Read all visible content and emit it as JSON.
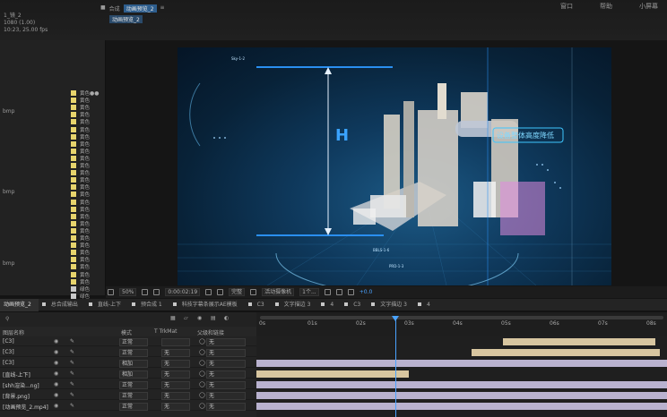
{
  "top": {
    "menu_right": [
      "窗口",
      "帮助",
      "小屏幕"
    ],
    "title_info": [
      "1_镜_2",
      "1080 (1.00)",
      "10:23, 25.00 fps"
    ],
    "comp_tabs": [
      "合成",
      "动画预览_2"
    ],
    "viewer_tab": "动画预览_2"
  },
  "project": {
    "names": [
      "bmp",
      "bmp",
      "bmp"
    ],
    "items": [
      "黄色",
      "黄色",
      "黄色",
      "黄色",
      "黄色",
      "黄色",
      "黄色",
      "黄色",
      "黄色",
      "黄色",
      "黄色",
      "黄色",
      "黄色",
      "黄色",
      "黄色",
      "黄色",
      "黄色",
      "黄色",
      "黄色",
      "黄色",
      "黄色",
      "黄色",
      "黄色",
      "黄色",
      "黄色",
      "黄色",
      "黄色",
      "绿色",
      "绿色",
      "绿色"
    ]
  },
  "render": {
    "height_label": "H",
    "callout": "设备整体高度降低",
    "bottom_labels": [
      "BBLS-1-6",
      "PRD-1-3"
    ],
    "sky_label": "Sky-1-2"
  },
  "viewer_toolbar": {
    "zoom": "50%",
    "timecode": "0:00:02:19",
    "view_mode": "完整",
    "camera": "活动摄像机",
    "views": "1个...",
    "exposure": "+0.0"
  },
  "timeline_tabs": [
    "动画预览_2",
    "总合成输出",
    "直线-上下",
    "预合成 1",
    "科技字幕条展示AE模板",
    "C3",
    "文字描边 3",
    "4",
    "C3",
    "文字描边 3",
    "4"
  ],
  "layer_header": {
    "name": "图层名称",
    "mode": "模式",
    "trkmat": "T TrkMat",
    "parent": "父级和链接"
  },
  "layers": [
    {
      "name": "[C3]",
      "mode": "正常",
      "trkmat": "",
      "parent": "无"
    },
    {
      "name": "[C3]",
      "mode": "正常",
      "trkmat": "无",
      "parent": "无"
    },
    {
      "name": "[C3]",
      "mode": "相加",
      "trkmat": "无",
      "parent": "无"
    },
    {
      "name": "[直线-上下]",
      "mode": "相加",
      "trkmat": "无",
      "parent": "无"
    },
    {
      "name": "[shh渲染...ng]",
      "mode": "正常",
      "trkmat": "无",
      "parent": "无"
    },
    {
      "name": "[背景.png]",
      "mode": "正常",
      "trkmat": "无",
      "parent": "无"
    },
    {
      "name": "[动画预览_2.mp4]",
      "mode": "正常",
      "trkmat": "无",
      "parent": "无"
    }
  ],
  "ruler_ticks": [
    "0s",
    "01s",
    "02s",
    "03s",
    "04s",
    "05s",
    "06s",
    "07s",
    "08s"
  ],
  "colors": {
    "track_lavender": "#b9b2cf",
    "track_tan": "#d8c6a0",
    "cti_blue": "#4aa3ff",
    "swatch_yellow": "#e7d46c"
  }
}
